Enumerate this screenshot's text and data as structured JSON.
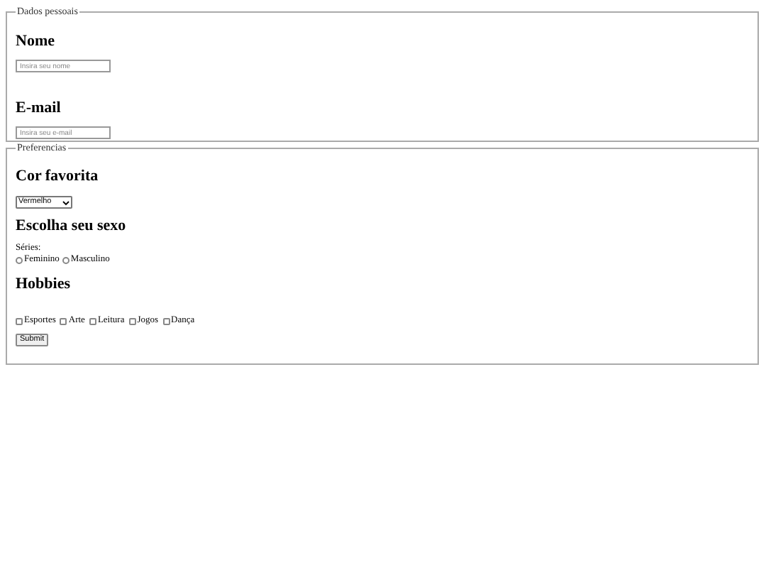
{
  "personal": {
    "legend": "Dados pessoais",
    "fields": [
      {
        "heading": "Nome",
        "placeholder": "Insira seu nome"
      },
      {
        "heading": "E-mail",
        "placeholder": "Insira seu e-mail"
      }
    ]
  },
  "preferences": {
    "legend": "Preferencias",
    "color": {
      "heading": "Cor favorita",
      "value": "Vermelho"
    },
    "sex": {
      "heading": "Escolha seu sexo",
      "label": "Séries:",
      "options": [
        {
          "label": "Feminino",
          "selected": false
        },
        {
          "label": "Masculino",
          "selected": false
        }
      ]
    },
    "hobbies": {
      "heading": "Hobbies",
      "options": [
        {
          "label": "Esportes",
          "checked": false
        },
        {
          "label": "Arte",
          "checked": false
        },
        {
          "label": "Leitura",
          "checked": false
        },
        {
          "label": "Jogos",
          "checked": false
        },
        {
          "label": "Dança",
          "checked": false
        }
      ]
    },
    "submit": "Submit"
  }
}
